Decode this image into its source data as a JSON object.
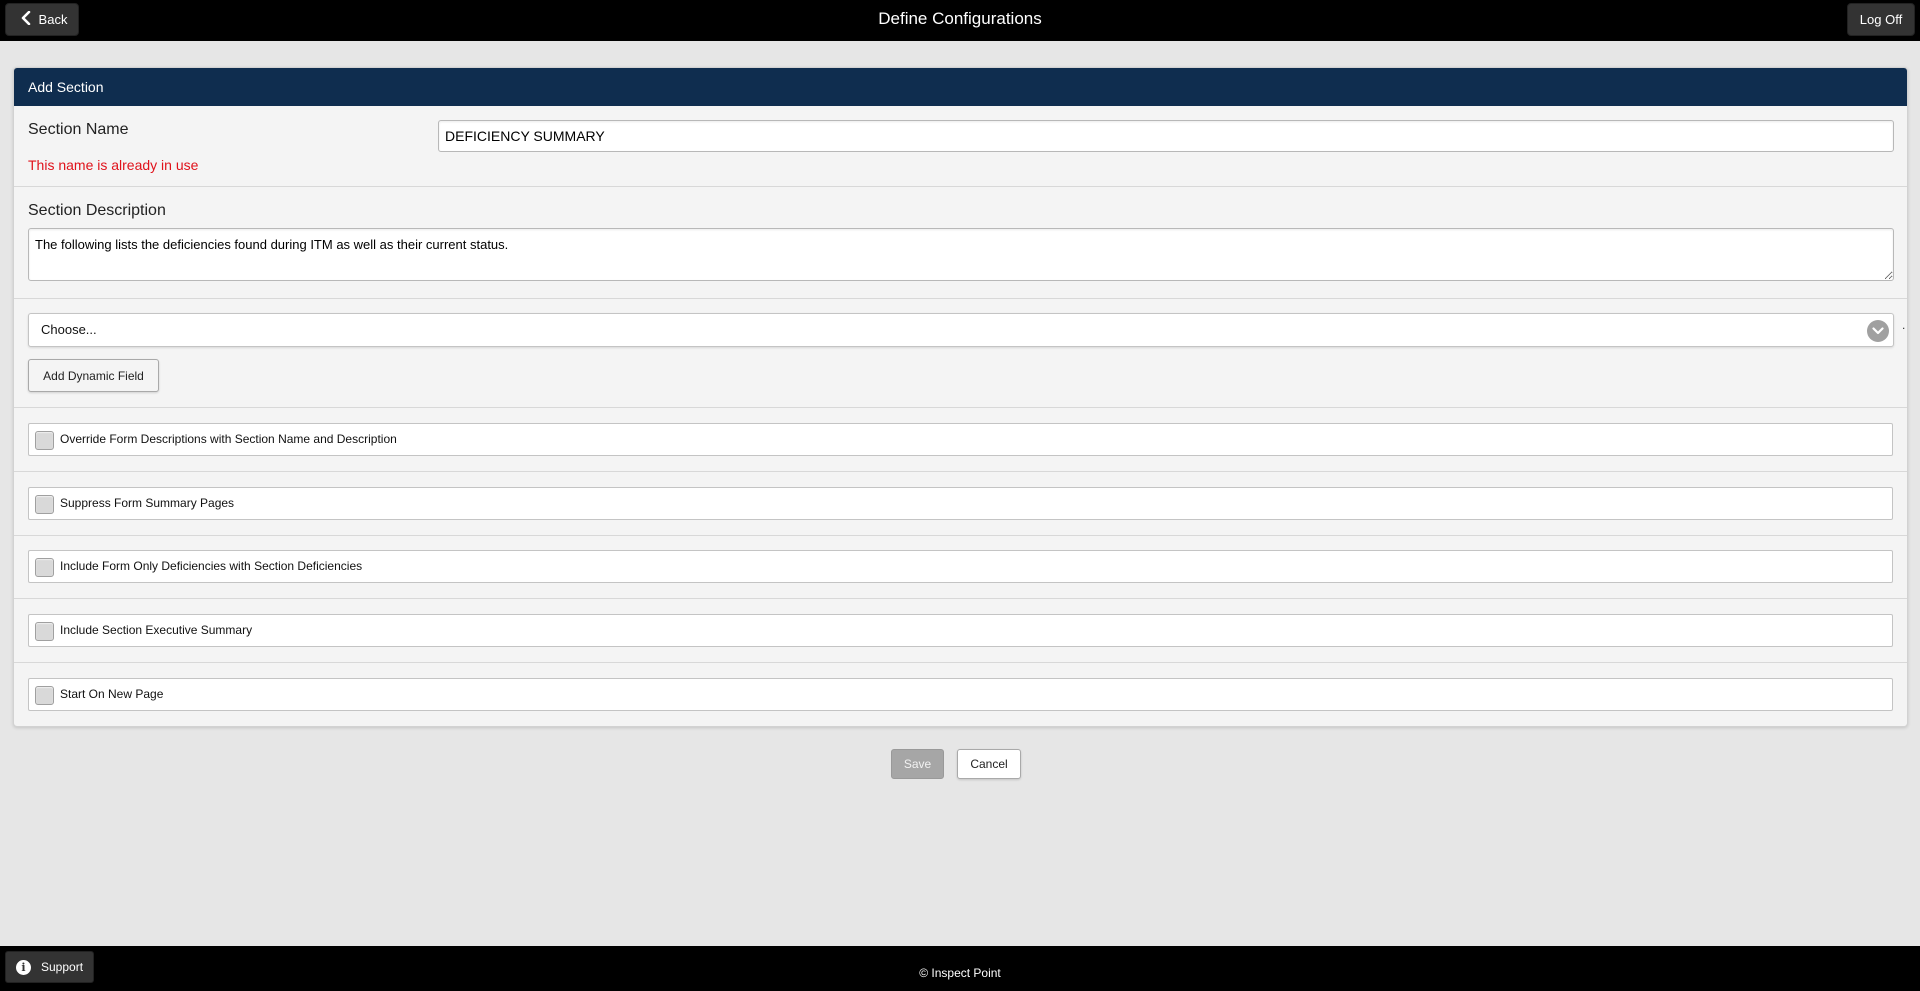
{
  "header": {
    "title": "Define Configurations",
    "back_label": "Back",
    "logoff_label": "Log Off"
  },
  "card": {
    "title": "Add Section",
    "section_name": {
      "label": "Section Name",
      "value": "DEFICIENCY SUMMARY",
      "error": "This name is already in use"
    },
    "section_description": {
      "label": "Section Description",
      "value": "The following lists the deficiencies found during ITM as well as their current status."
    },
    "dynamic_field": {
      "select_value": "Choose...",
      "add_label": "Add Dynamic Field",
      "trailing_mark": "."
    },
    "options": [
      {
        "label": "Override Form Descriptions with Section Name and Description",
        "checked": false
      },
      {
        "label": "Suppress Form Summary Pages",
        "checked": false
      },
      {
        "label": "Include Form Only Deficiencies with Section Deficiencies",
        "checked": false
      },
      {
        "label": "Include Section Executive Summary",
        "checked": false
      },
      {
        "label": "Start On New Page",
        "checked": false
      }
    ]
  },
  "actions": {
    "save_label": "Save",
    "cancel_label": "Cancel"
  },
  "footer": {
    "support_label": "Support",
    "copyright": "© Inspect Point"
  },
  "colors": {
    "header_bg": "#000000",
    "card_header_bg": "#0f2d4f",
    "error": "#e0121b",
    "page_bg": "#e6e6e6"
  }
}
